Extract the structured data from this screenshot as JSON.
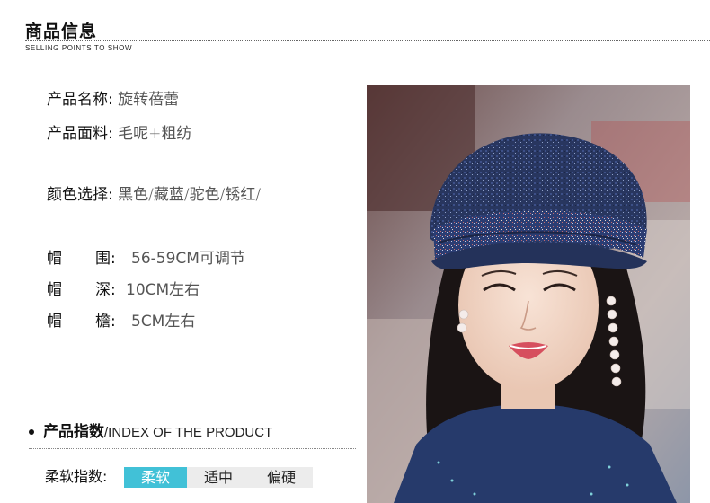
{
  "header": {
    "title": "商品信息",
    "subtitle": "SELLING POINTS TO SHOW"
  },
  "specs": {
    "name": {
      "label": "产品名称:",
      "value": "旋转蓓蕾"
    },
    "fabric": {
      "label": "产品面料:",
      "value": "毛呢+粗纺"
    },
    "colors": {
      "label": "颜色选择:",
      "value": "黑色/藏蓝/驼色/锈红/"
    },
    "circumference": {
      "c1": "帽",
      "c2": "围:",
      "value": "56-59CM可调节"
    },
    "depth": {
      "c1": "帽",
      "c2": "深:",
      "value": "10CM左右"
    },
    "brim": {
      "c1": "帽",
      "c2": "檐:",
      "value": "5CM左右"
    }
  },
  "index": {
    "title_zh": "产品指数",
    "title_en": "/INDEX OF THE PRODUCT"
  },
  "softness": {
    "label": "柔软指数:",
    "options": [
      "柔软",
      "适中",
      "偏硬"
    ],
    "selected": "柔软"
  },
  "colors": {
    "accent": "#41c1d7",
    "hat": "#27345f",
    "sweater": "#263a6b"
  },
  "photo": {
    "icon": "product-photo-woman-wearing-navy-beret"
  }
}
